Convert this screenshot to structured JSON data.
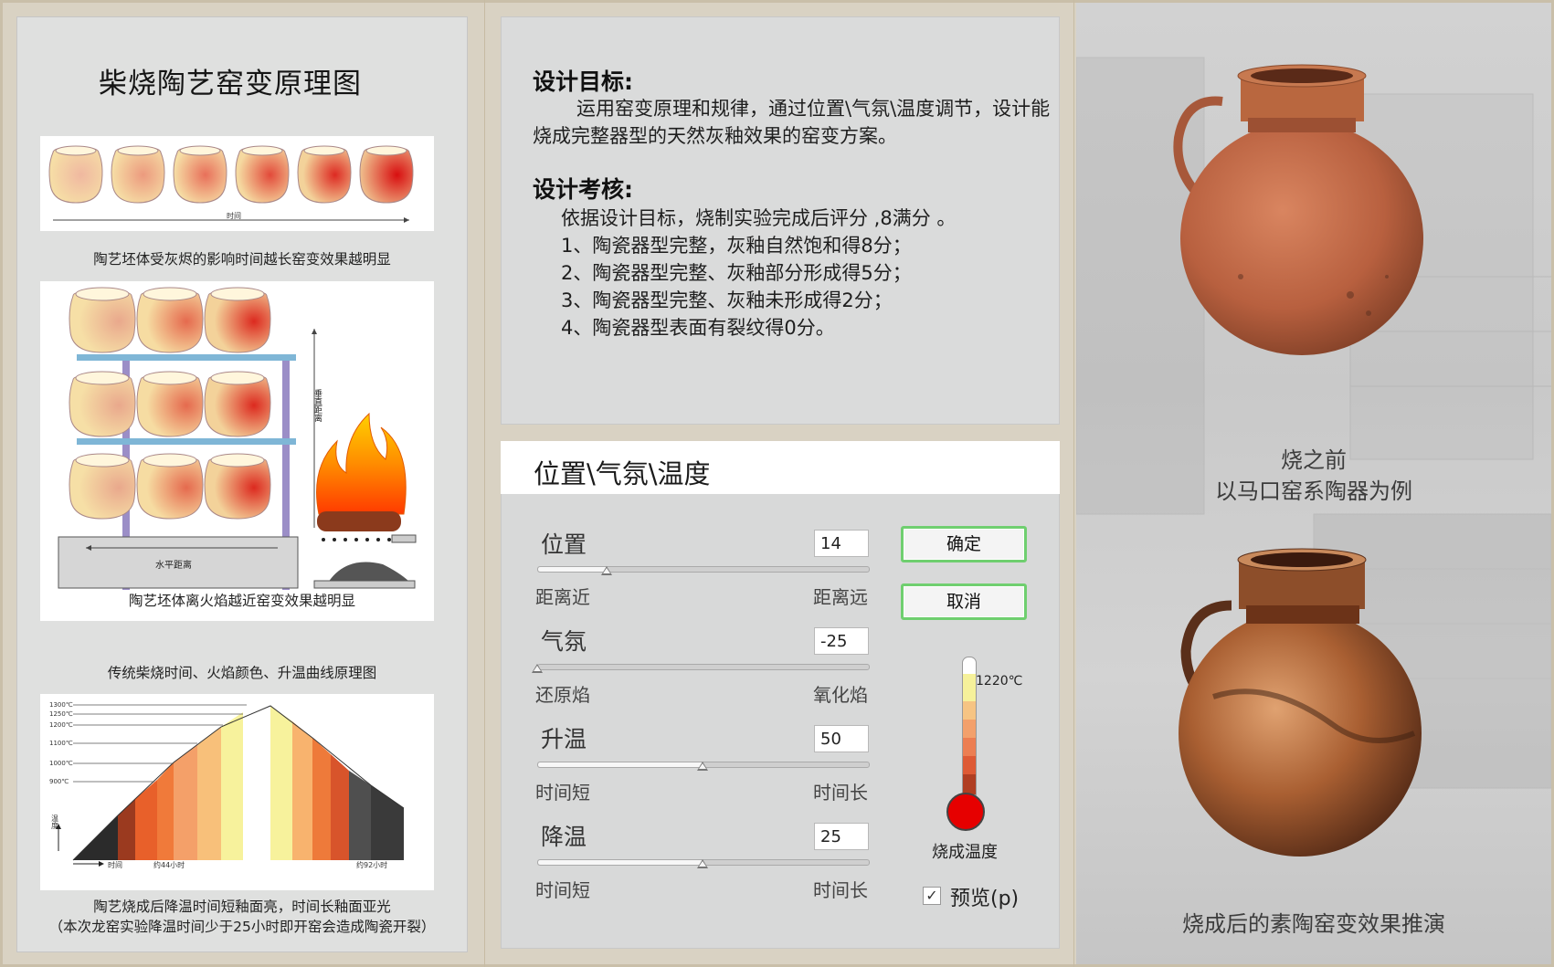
{
  "left_panel": {
    "title": "柴烧陶艺窑变原理图",
    "fig1": {
      "time_label": "时间",
      "caption": "陶艺坯体受灰烬的影响时间越长窑变效果越明显"
    },
    "fig2": {
      "vertical_label": "垂直距离",
      "horizontal_label": "水平距离",
      "caption": "陶艺坯体离火焰越近窑变效果越明显"
    },
    "fig3": {
      "title": "传统柴烧时间、火焰颜色、升温曲线原理图",
      "y_ticks": [
        "1300℃",
        "1250℃",
        "1200℃",
        "1100℃",
        "1000℃",
        "900℃"
      ],
      "y_label": "温度",
      "x_label_start": "时间",
      "x_label_mid": "约44小时",
      "x_label_end": "约92小时",
      "caption_line1": "陶艺烧成后降温时间短釉面亮，时间长釉面亚光",
      "caption_line2": "（本次龙窑实验降温时间少于25小时即开窑会造成陶瓷开裂）"
    }
  },
  "design": {
    "goal_heading": "设计目标:",
    "goal_text": "运用窑变原理和规律，通过位置\\气氛\\温度调节，设计能烧成完整器型的天然灰釉效果的窑变方案。",
    "exam_heading": "设计考核:",
    "exam_lines": [
      "依据设计目标，烧制实验完成后评分 ,8满分 。",
      "1、陶瓷器型完整，灰釉自然饱和得8分；",
      "2、陶瓷器型完整、灰釉部分形成得5分；",
      "3、陶瓷器型完整、灰釉未形成得2分；",
      "4、陶瓷器型表面有裂纹得0分。"
    ]
  },
  "controls": {
    "header": "位置\\气氛\\温度",
    "params": [
      {
        "label": "位置",
        "value": "14",
        "left": "距离近",
        "right": "距离远",
        "fraction": 0.21
      },
      {
        "label": "气氛",
        "value": "-25",
        "left": "还原焰",
        "right": "氧化焰",
        "fraction": 0.0
      },
      {
        "label": "升温",
        "value": "50",
        "left": "时间短",
        "right": "时间长",
        "fraction": 0.5
      },
      {
        "label": "降温",
        "value": "25",
        "left": "时间短",
        "right": "时间长",
        "fraction": 0.5
      }
    ],
    "confirm_label": "确定",
    "cancel_label": "取消",
    "thermo_value": "1220℃",
    "thermo_caption": "烧成温度",
    "preview_check": "✓",
    "preview_label": "预览(p)"
  },
  "right_panel": {
    "before_line1": "烧之前",
    "before_line2": "以马口窑系陶器为例",
    "after_caption": "烧成后的素陶窑变效果推演"
  }
}
